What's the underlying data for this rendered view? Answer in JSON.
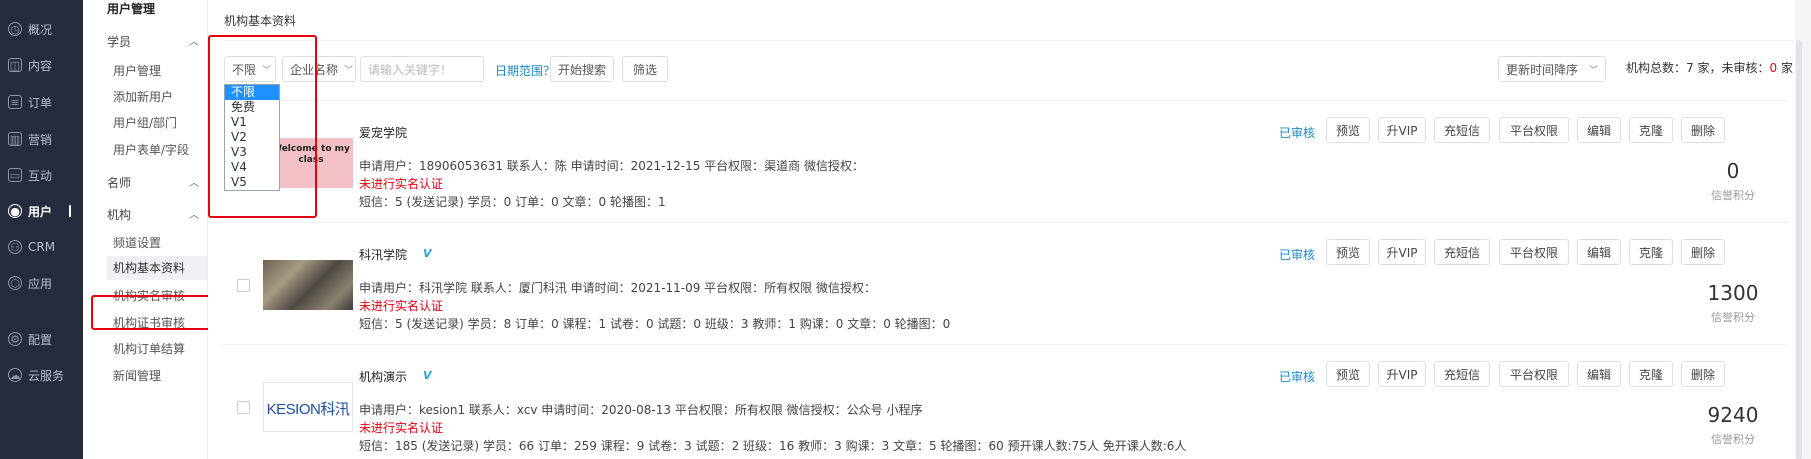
{
  "nav": {
    "items": [
      {
        "icon": "clock-icon",
        "glyph": "◷",
        "label": "概况"
      },
      {
        "icon": "book-icon",
        "glyph": "◫",
        "label": "内容"
      },
      {
        "icon": "order-icon",
        "glyph": "≡",
        "label": "订单"
      },
      {
        "icon": "chart-icon",
        "glyph": "▥",
        "label": "营销"
      },
      {
        "icon": "chat-icon",
        "glyph": "▭",
        "label": "互动"
      },
      {
        "icon": "user-icon",
        "glyph": "●",
        "label": "用户"
      },
      {
        "icon": "crm-icon",
        "glyph": "⚇",
        "label": "CRM"
      },
      {
        "icon": "app-icon",
        "glyph": "⬡",
        "label": "应用"
      },
      {
        "icon": "gear-icon",
        "glyph": "⚙",
        "label": "配置"
      },
      {
        "icon": "cloud-icon",
        "glyph": "☁",
        "label": "云服务"
      }
    ]
  },
  "submenu": {
    "title": "用户管理",
    "groups": {
      "student": {
        "label": "学员",
        "items": [
          "用户管理",
          "添加新用户",
          "用户组/部门",
          "用户表单/字段"
        ]
      },
      "teacher": {
        "label": "名师"
      },
      "org": {
        "label": "机构",
        "items": [
          "频道设置",
          "机构基本资料",
          "机构实名审核",
          "机构证书审核",
          "机构订单结算",
          "新闻管理"
        ]
      }
    }
  },
  "main": {
    "page_title": "机构基本资料",
    "filter": {
      "level_value": "不限",
      "level_options": [
        "不限",
        "免费",
        "V1",
        "V2",
        "V3",
        "V4",
        "V5"
      ],
      "field_value": "企业名称",
      "keyword_placeholder": "请输入关键字！",
      "date_range_label": "日期范围？",
      "search_label": "开始搜索",
      "filter_label": "筛选",
      "sort_value": "更新时间降序"
    },
    "stat": {
      "prefix": "机构总数：",
      "total": "7",
      "mid": " 家，未审核：",
      "pending": "0",
      "suffix": " 家"
    },
    "row_buttons": {
      "preview": "预览",
      "vip": "升VIP",
      "sms": "充短信",
      "perm": "平台权限",
      "edit": "编辑",
      "clone": "克隆",
      "delete": "删除"
    },
    "score_label": "信誉积分",
    "rows": [
      {
        "name": "爱宠学院",
        "verified_badge": "",
        "thumb_text": "Welcome to my class",
        "apply_line": "申请用户：18906053631  联系人：陈  申请时间：2021-12-15   平台权限：渠道商   微信授权：",
        "warning": "未进行实名认证",
        "stats_line": "短信：5 (发送记录)   学员：0   订单：0   文章：0   轮播图：1",
        "status": "已审核",
        "score": "0"
      },
      {
        "name": "科汛学院",
        "verified_badge": "V",
        "thumb_text": "",
        "apply_line": "申请用户：科汛学院  联系人：厦门科汛   申请时间：2021-11-09   平台权限：所有权限   微信授权：",
        "warning": "未进行实名认证",
        "stats_line": "短信：5 (发送记录)   学员：8   订单：0   课程：1 试卷：0   试题：0   班级：3   教师：1   购课：0   文章：0   轮播图：0",
        "status": "已审核",
        "score": "1300"
      },
      {
        "name": "机构演示",
        "verified_badge": "V",
        "thumb_text": "KESION科汛",
        "apply_line": "申请用户：kesion1  联系人：xcv   申请时间：2020-08-13   平台权限：所有权限   微信授权：公众号 小程序",
        "warning": "未进行实名认证",
        "stats_line": "短信：185 (发送记录)   学员：66   订单：259   课程：9 试卷：3   试题：2   班级：16   教师：3   购课：3   文章：5   轮播图：60   预开课人数:75人   免开课人数:6人",
        "status": "已审核",
        "score": "9240"
      }
    ]
  }
}
